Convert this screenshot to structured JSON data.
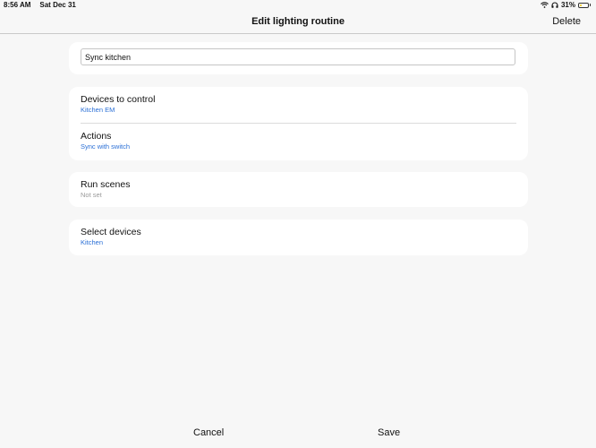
{
  "status_bar": {
    "time": "8:56 AM",
    "date": "Sat Dec 31",
    "battery_percent": "31%",
    "battery_level": 0.31,
    "battery_color": "#f2c200",
    "icons": [
      "wifi-icon",
      "headphones-icon",
      "battery-icon"
    ]
  },
  "nav": {
    "title": "Edit lighting routine",
    "delete_label": "Delete"
  },
  "routine": {
    "name_value": "Sync kitchen"
  },
  "sections": {
    "devices_to_control": {
      "title": "Devices to control",
      "value": "Kitchen EM"
    },
    "actions": {
      "title": "Actions",
      "value": "Sync with switch"
    },
    "run_scenes": {
      "title": "Run scenes",
      "value": "Not set"
    },
    "select_devices": {
      "title": "Select devices",
      "value": "Kitchen"
    }
  },
  "footer": {
    "cancel_label": "Cancel",
    "save_label": "Save"
  },
  "colors": {
    "accent": "#2a6fd6",
    "muted": "#9a9a9a",
    "background": "#f7f7f7",
    "card": "#ffffff"
  }
}
